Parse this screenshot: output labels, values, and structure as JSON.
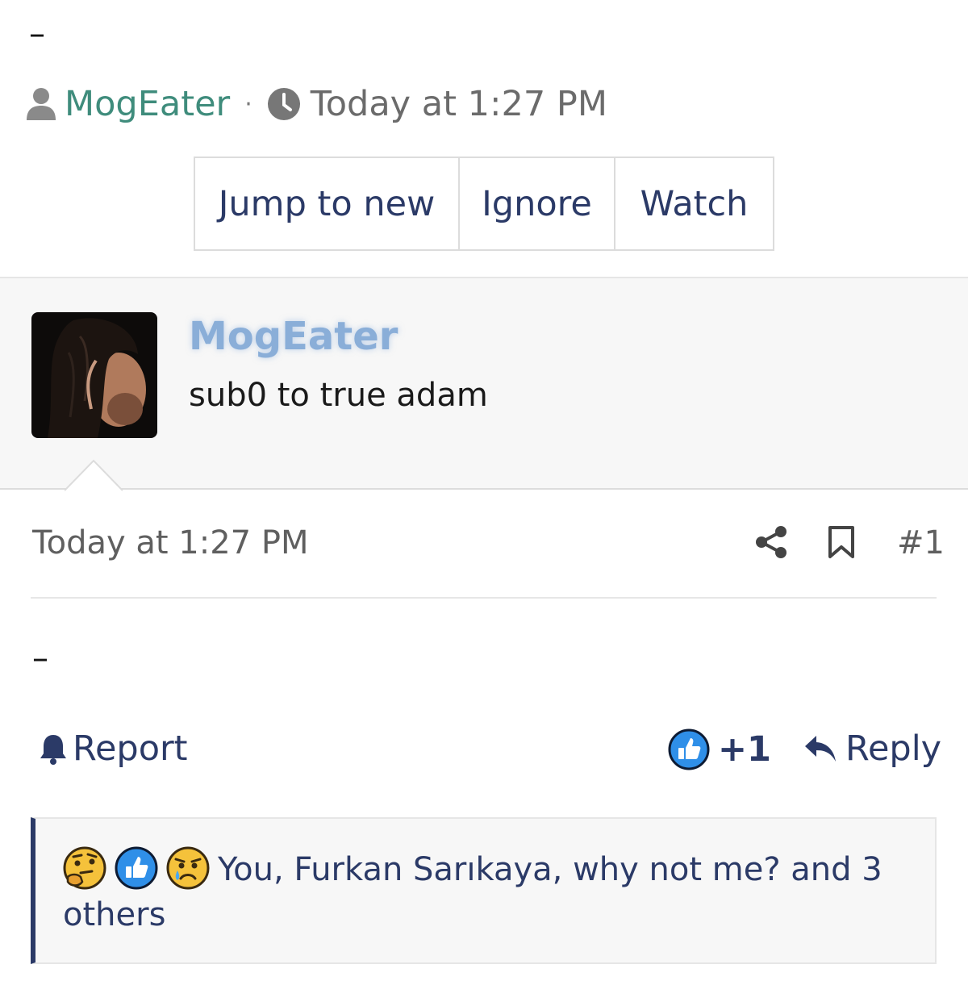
{
  "top_separator": "–",
  "thread_meta": {
    "author": "MogEater",
    "separator": "·",
    "date": "Today at 1:27 PM"
  },
  "thread_buttons": {
    "jump": "Jump to new",
    "ignore": "Ignore",
    "watch": "Watch"
  },
  "latest_post": {
    "username": "MogEater",
    "text": "sub0 to true adam"
  },
  "post": {
    "date": "Today at 1:27 PM",
    "number": "#1",
    "body": "–",
    "report_label": "Report",
    "like_count": "+1",
    "reply_label": "Reply"
  },
  "reactions": {
    "text": "You, Furkan Sarıkaya, why not me? and 3 others",
    "icons": [
      "thinking-emoji",
      "like-emoji",
      "crying-emoji"
    ]
  },
  "colors": {
    "accent": "#2b3a67",
    "author_green": "#3f8c7c",
    "latest_user_blue": "#8aaed8"
  }
}
